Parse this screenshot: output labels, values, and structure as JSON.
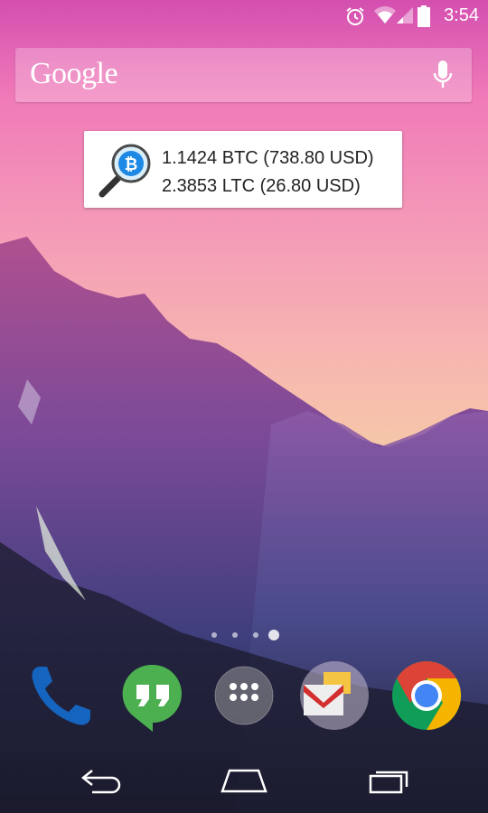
{
  "status_bar": {
    "time": "3:54"
  },
  "search": {
    "logo": "Google"
  },
  "widget": {
    "btc_line": "1.1424 BTC (738.80 USD)",
    "ltc_line": "2.3853 LTC (26.80 USD)"
  },
  "home_pages": {
    "count": 4,
    "active_index": 3
  },
  "dock": {
    "apps": [
      "Phone",
      "Hangouts",
      "Apps",
      "Gmail",
      "Chrome"
    ]
  },
  "colors": {
    "phone_blue": "#1565c0",
    "hangouts_green": "#4caf50",
    "gmail_red": "#d32f2f",
    "chrome_red": "#db4437",
    "chrome_yellow": "#f4b400",
    "chrome_green": "#0f9d58",
    "chrome_blue": "#4285f4",
    "bitcoin_blue": "#1e88e5"
  }
}
